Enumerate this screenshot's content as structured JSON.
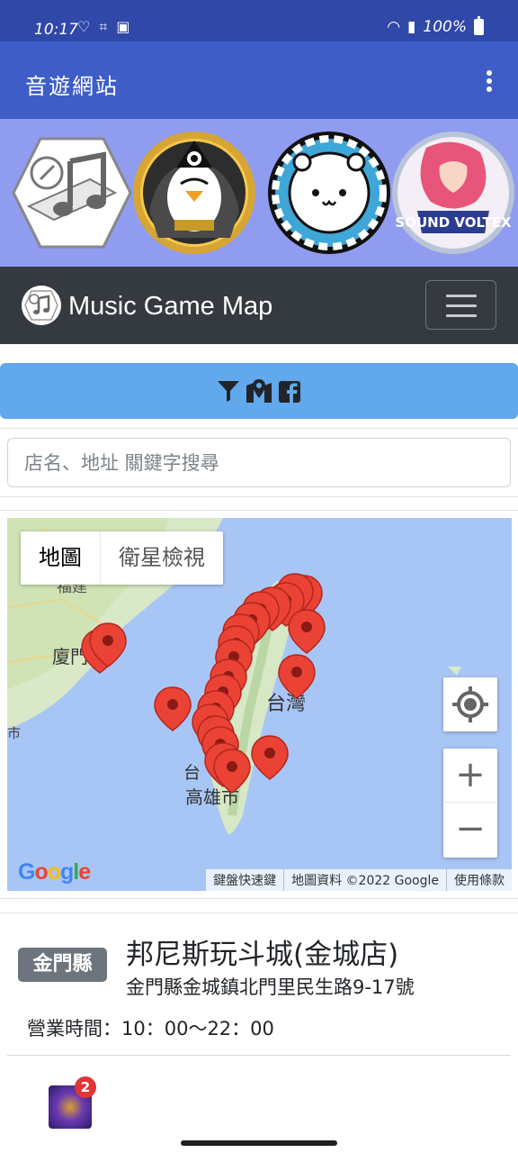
{
  "status_bar": {
    "time": "10:17",
    "battery": "100%"
  },
  "app_bar": {
    "title": "音遊網站"
  },
  "games": [
    {
      "name": "music-note-hex-icon"
    },
    {
      "name": "penguin-icon"
    },
    {
      "name": "bear-icon"
    },
    {
      "name": "sound-voltex-icon",
      "label": "SOUND VOLTEX"
    }
  ],
  "navbar": {
    "brand": "Music Game Map"
  },
  "search": {
    "placeholder": "店名、地址 關鍵字搜尋"
  },
  "map": {
    "tab_map": "地圖",
    "tab_satellite": "衛星檢視",
    "footer_shortcuts": "鍵盤快速鍵",
    "footer_data": "地圖資料 ©2022 Google",
    "footer_terms": "使用條款",
    "google_logo": "Google",
    "place_labels": {
      "xiamen": "廈門",
      "taiwan": "台灣",
      "kaohsiung": "高雄市",
      "fujian": "福建",
      "tai": "台",
      "shi": "市"
    }
  },
  "store": {
    "county_badge": "金門縣",
    "name": "邦尼斯玩斗城(金城店)",
    "address": "金門縣金城鎮北門里民生路9-17號",
    "hours": "營業時間：10：00～22：00",
    "machine_count": "2"
  }
}
